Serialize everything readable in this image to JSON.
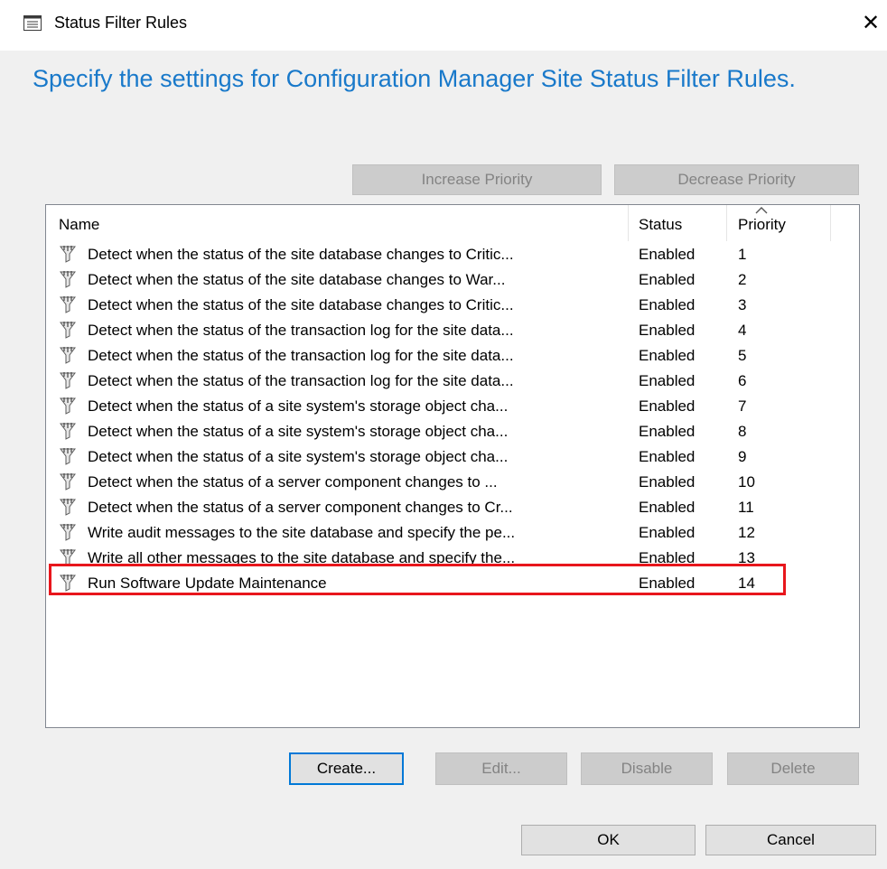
{
  "window": {
    "title": "Status Filter Rules",
    "close_label": "✕"
  },
  "heading": "Specify the settings for Configuration Manager Site Status Filter Rules.",
  "priority_buttons": {
    "increase": "Increase Priority",
    "decrease": "Decrease Priority"
  },
  "table": {
    "columns": [
      "Name",
      "Status",
      "Priority"
    ],
    "rows": [
      {
        "name": "Detect when the status of the site database changes to Critic...",
        "status": "Enabled",
        "priority": "1"
      },
      {
        "name": "Detect when the status of the site database changes to War...",
        "status": "Enabled",
        "priority": "2"
      },
      {
        "name": "Detect when the status of the site database changes to Critic...",
        "status": "Enabled",
        "priority": "3"
      },
      {
        "name": "Detect when the status of the transaction log for the site data...",
        "status": "Enabled",
        "priority": "4"
      },
      {
        "name": "Detect when the status of the transaction log for the site data...",
        "status": "Enabled",
        "priority": "5"
      },
      {
        "name": "Detect when the status of the transaction log for the site data...",
        "status": "Enabled",
        "priority": "6"
      },
      {
        "name": "Detect when the status of a site system's storage object cha...",
        "status": "Enabled",
        "priority": "7"
      },
      {
        "name": "Detect when the status of a site system's storage object cha...",
        "status": "Enabled",
        "priority": "8"
      },
      {
        "name": "Detect when the status of a site system's storage object cha...",
        "status": "Enabled",
        "priority": "9"
      },
      {
        "name": "Detect when the status of a server component changes to ...",
        "status": "Enabled",
        "priority": "10"
      },
      {
        "name": "Detect when the status of a server component changes to Cr...",
        "status": "Enabled",
        "priority": "11"
      },
      {
        "name": "Write audit messages to the site database and specify the pe...",
        "status": "Enabled",
        "priority": "12"
      },
      {
        "name": "Write all other messages to the site database and specify the...",
        "status": "Enabled",
        "priority": "13"
      },
      {
        "name": "Run Software Update Maintenance",
        "status": "Enabled",
        "priority": "14"
      }
    ],
    "row_icon": "filter-rule-icon",
    "sort_icon": "sort-ascending-icon",
    "highlighted_row_index": 13,
    "highlight_color": "#e8161c"
  },
  "action_buttons": {
    "create": "Create...",
    "edit": "Edit...",
    "disable": "Disable",
    "delete": "Delete"
  },
  "dialog_buttons": {
    "ok": "OK",
    "cancel": "Cancel"
  },
  "colors": {
    "heading": "#1979ca",
    "default_button_border": "#0078d7"
  }
}
